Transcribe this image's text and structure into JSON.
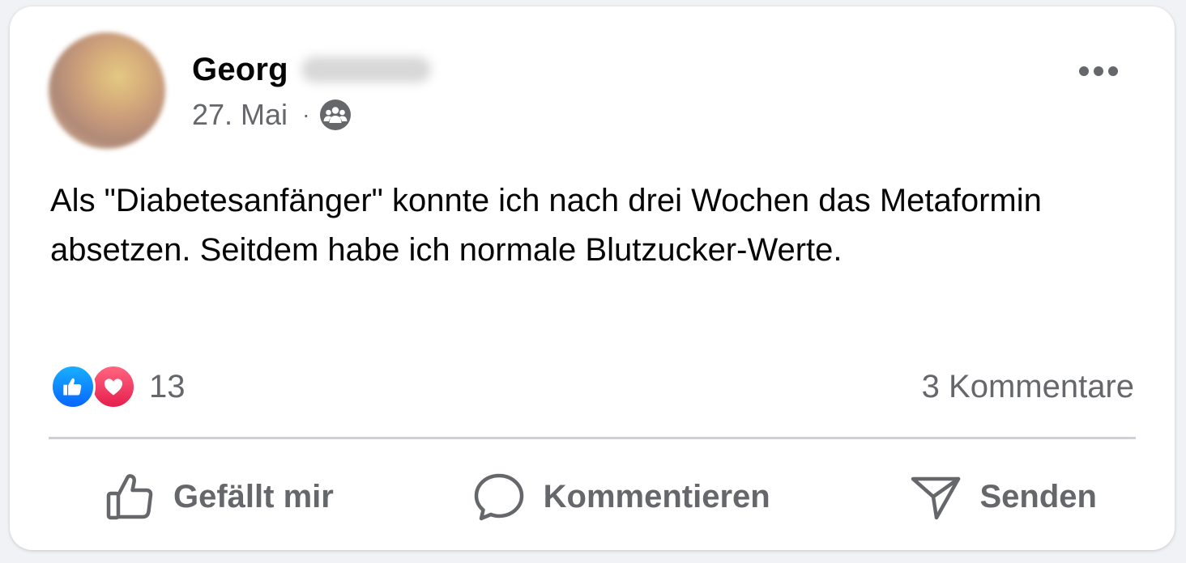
{
  "post": {
    "author_first_name": "Georg",
    "date": "27. Mai",
    "separator": "·",
    "audience_icon": "group-icon",
    "text": "Als \"Diabetesanfänger\" konnte ich nach drei Wochen das Metaformin absetzen. Seitdem habe ich normale Blutzucker-Werte.",
    "reaction_icons": [
      "like-icon",
      "love-icon"
    ],
    "reaction_count": "13",
    "comments_count": "3 Kommentare",
    "more_icon": "more-horizontal-icon"
  },
  "actions": {
    "like_label": "Gefällt mir",
    "comment_label": "Kommentieren",
    "send_label": "Senden"
  },
  "colors": {
    "text_primary": "#050505",
    "text_secondary": "#65676b",
    "like_blue": "#0866ff",
    "love_red": "#e61e4d",
    "divider": "#ced0d4",
    "card_background": "#ffffff"
  }
}
